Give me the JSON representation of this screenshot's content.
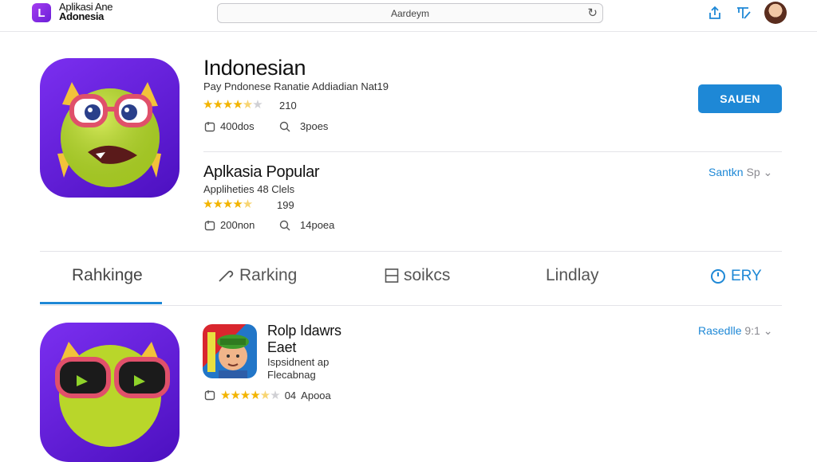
{
  "topbar": {
    "logo_glyph": "L",
    "brand_line1": "Aplikasi Ane",
    "brand_line2": "Adonesia",
    "search_text": "Aardeym",
    "reload_icon": "reload-icon",
    "share_icon": "share-icon",
    "bookmark_icon": "bookmark-icon"
  },
  "hero": {
    "title": "Indonesian",
    "subtitle": "Pay Pndonese Ranatie Addiadian Nat19",
    "stars_on": "★★★★",
    "stars_half": "★",
    "stars_off": "★",
    "rating_count": "210",
    "downloads": "400dos",
    "size": "3poes",
    "button_label": "SAUEN"
  },
  "popular": {
    "title": "Aplkasia Popular",
    "subtitle": "Appliheties 48 Clels",
    "stars_on": "★★★★",
    "stars_half": "★",
    "stars_off": "",
    "rating_count": "199",
    "downloads": "200non",
    "size": "14poea",
    "see_all_label": "Santkn",
    "see_all_extra": "Sp",
    "chevron": "⌄"
  },
  "tabs": [
    {
      "label": "Rahkinge"
    },
    {
      "label": "Rarking"
    },
    {
      "label": "soikcs"
    },
    {
      "label": "Lindlay"
    },
    {
      "label": "ERY"
    }
  ],
  "list": {
    "item_title_line1": "Rolp Idawrs",
    "item_title_line2": "Eaet",
    "item_desc_line1": "Ispsidnent ap",
    "item_desc_line2": "Flecabnag",
    "stars_on": "★★★★",
    "stars_half": "★",
    "stars_off": "★",
    "rating_count": "04",
    "size": "Apooa",
    "side_link": "Rasedlle",
    "side_extra": "9:1",
    "chevron": "⌄"
  },
  "colors": {
    "accent": "#1e88d6",
    "star": "#f3b400",
    "icon_bg": "#6a1fd8"
  }
}
